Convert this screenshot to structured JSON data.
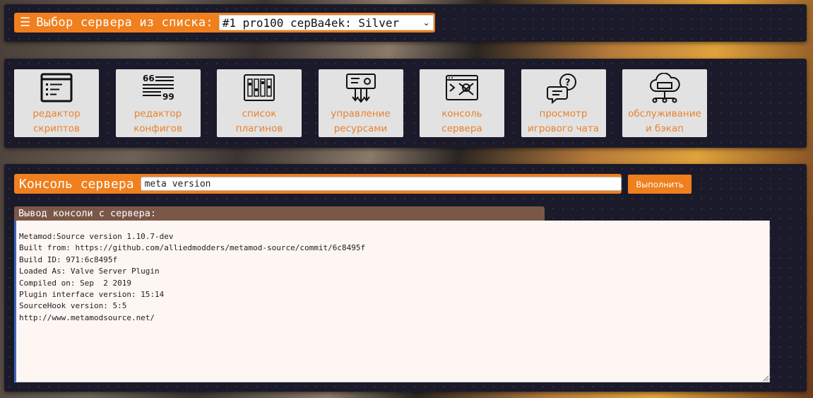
{
  "server_selector": {
    "menu_icon": "hamburger-icon",
    "label": "Выбор сервера из списка:",
    "selected": "#1 pro100 cepBa4ek: Silver"
  },
  "tools": [
    {
      "icon": "script-editor-icon",
      "line1": "редактор",
      "line2": "скриптов"
    },
    {
      "icon": "config-editor-icon",
      "line1": "редактор",
      "line2": "конфигов"
    },
    {
      "icon": "plugins-list-icon",
      "line1": "список",
      "line2": "плагинов"
    },
    {
      "icon": "resources-icon",
      "line1": "управление",
      "line2": "ресурсами"
    },
    {
      "icon": "console-icon",
      "line1": "консоль",
      "line2": "сервера"
    },
    {
      "icon": "chat-icon",
      "line1": "просмотр",
      "line2": "игрового чата"
    },
    {
      "icon": "backup-icon",
      "line1": "обслуживание",
      "line2": "и бэкап"
    }
  ],
  "console": {
    "title": "Консоль сервера",
    "command_value": "meta version",
    "run_label": "Выполнить",
    "output_header": "Вывод консоли с сервера:",
    "output_lines": [
      "Metamod:Source version 1.10.7-dev",
      "Built from: https://github.com/alliedmodders/metamod-source/commit/6c8495f",
      "Build ID: 971:6c8495f",
      "Loaded As: Valve Server Plugin",
      "Compiled on: Sep  2 2019",
      "Plugin interface version: 15:14",
      "SourceHook version: 5:5",
      "http://www.metamodsource.net/"
    ]
  },
  "colors": {
    "accent": "#f07f1e",
    "panel": "#1b1a2a",
    "tile_bg": "#e2e2e2",
    "tile_text": "#e8832e",
    "output_header": "#7b5748",
    "output_bg": "#fdf6f3"
  }
}
